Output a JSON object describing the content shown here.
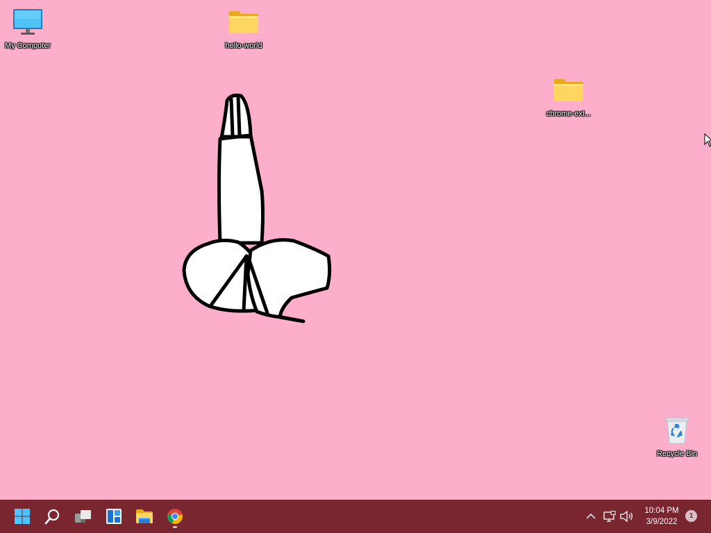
{
  "desktop": {
    "background_color": "#fcaecb",
    "icons": [
      {
        "label": "My Computer",
        "icon": "monitor-icon"
      },
      {
        "label": "hello-world",
        "icon": "folder-icon"
      },
      {
        "label": "chrome-ext...",
        "icon": "folder-icon"
      },
      {
        "label": "Recycle Bin",
        "icon": "recycle-bin-icon"
      }
    ]
  },
  "taskbar": {
    "background_color": "#7a2630",
    "pinned": [
      {
        "name": "Start",
        "icon": "windows-start-icon"
      },
      {
        "name": "Search",
        "icon": "search-icon"
      },
      {
        "name": "Task View",
        "icon": "task-view-icon"
      },
      {
        "name": "Widgets",
        "icon": "widgets-icon"
      },
      {
        "name": "File Explorer",
        "icon": "file-explorer-icon"
      },
      {
        "name": "Google Chrome",
        "icon": "chrome-icon"
      }
    ],
    "tray": {
      "icons": [
        "chevron-up-icon",
        "network-icon",
        "volume-icon"
      ],
      "time": "10:04 PM",
      "date": "3/9/2022",
      "notification_count": "1"
    }
  }
}
